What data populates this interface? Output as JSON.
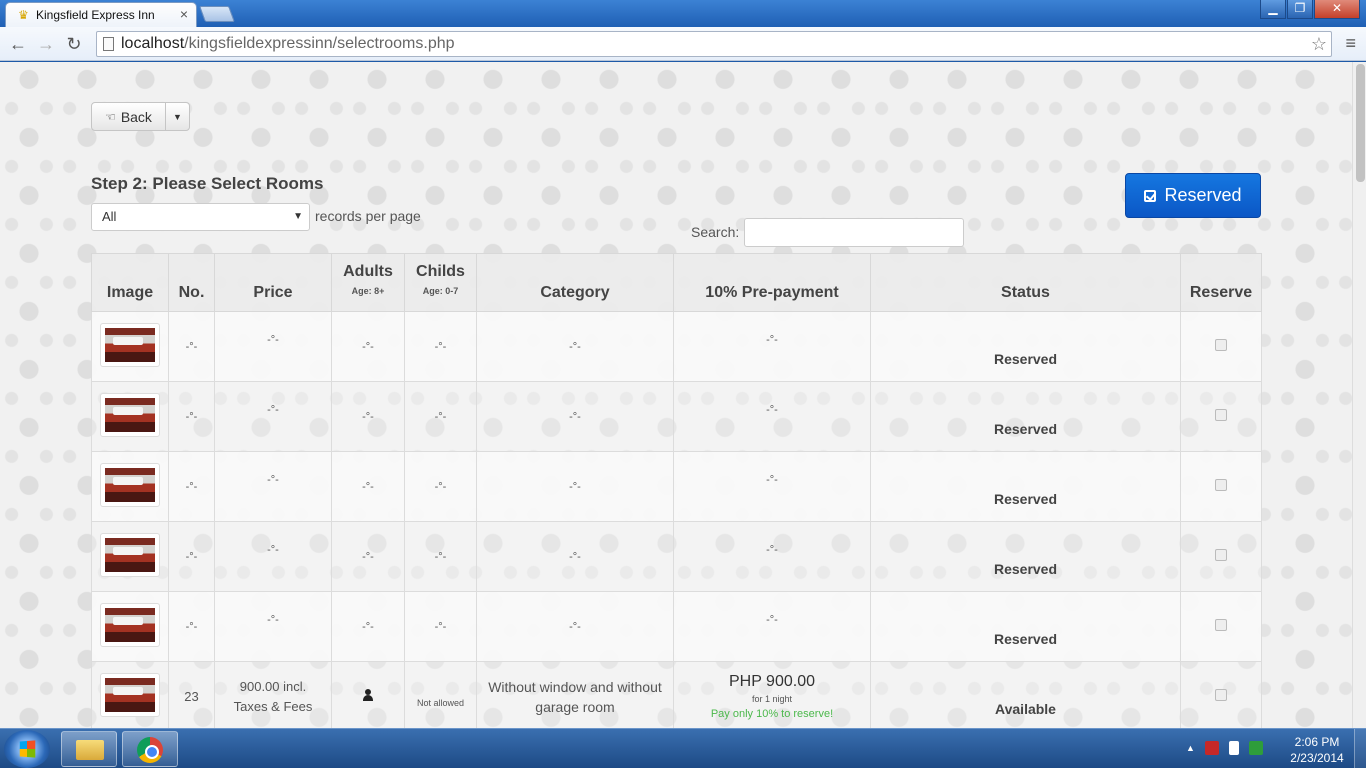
{
  "browser": {
    "tab_title": "Kingsfield Express Inn",
    "url_host": "localhost",
    "url_path": "/kingsfieldexpressinn/selectrooms.php"
  },
  "page": {
    "back_label": "Back",
    "step_title": "Step 2: Please Select Rooms",
    "length_value": "All",
    "length_suffix": "records per page",
    "search_label": "Search:",
    "search_value": "",
    "reserved_button": "Reserved"
  },
  "table": {
    "headers": {
      "image": "Image",
      "no": "No.",
      "price": "Price",
      "adults": "Adults",
      "adults_sub": "Age: 8+",
      "childs": "Childs",
      "childs_sub": "Age: 0-7",
      "category": "Category",
      "prepayment": "10% Pre-payment",
      "status": "Status",
      "reserve": "Reserve"
    },
    "rows": [
      {
        "no": "-°-",
        "price": "-°-",
        "adults": "-°-",
        "childs": "-°-",
        "category": "-°-",
        "prepay": "-°-",
        "status": "Reserved"
      },
      {
        "no": "-°-",
        "price": "-°-",
        "adults": "-°-",
        "childs": "-°-",
        "category": "-°-",
        "prepay": "-°-",
        "status": "Reserved"
      },
      {
        "no": "-°-",
        "price": "-°-",
        "adults": "-°-",
        "childs": "-°-",
        "category": "-°-",
        "prepay": "-°-",
        "status": "Reserved"
      },
      {
        "no": "-°-",
        "price": "-°-",
        "adults": "-°-",
        "childs": "-°-",
        "category": "-°-",
        "prepay": "-°-",
        "status": "Reserved"
      },
      {
        "no": "-°-",
        "price": "-°-",
        "adults": "-°-",
        "childs": "-°-",
        "category": "-°-",
        "prepay": "-°-",
        "status": "Reserved"
      },
      {
        "no": "23",
        "price_line1": "900.00 incl.",
        "price_line2": "Taxes & Fees",
        "adults_icon": "person-icon",
        "childs": "Not allowed",
        "category": "Without window and without garage room",
        "prepay": "PHP 900.00",
        "prepay_note": "for 1 night",
        "prepay_green": "Pay only 10% to reserve!",
        "status": "Available"
      }
    ]
  },
  "taskbar": {
    "time": "2:06 PM",
    "date": "2/23/2014"
  },
  "colors": {
    "primary_button": "#0b63d1",
    "available_green": "#4cb84c"
  }
}
